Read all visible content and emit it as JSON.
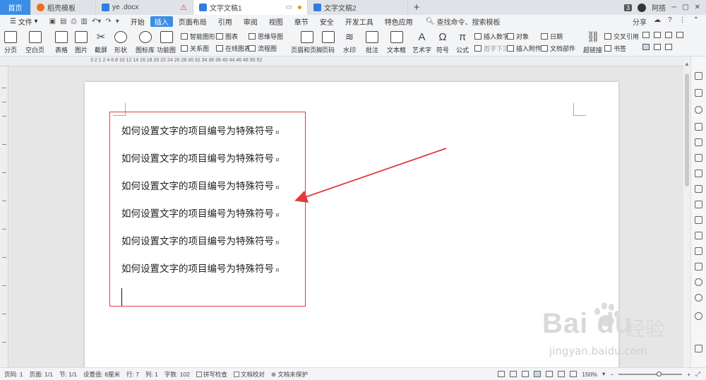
{
  "tabs": [
    {
      "label": "首页",
      "icon": "home-tab"
    },
    {
      "label": "稻壳模板",
      "icon": "docer-icon"
    },
    {
      "label": "ye .docx",
      "icon": "word-doc-icon"
    },
    {
      "label": "文字文稿1",
      "icon": "word-doc-icon"
    },
    {
      "label": "文字文稿2",
      "icon": "word-doc-icon"
    }
  ],
  "tab_add": "+",
  "topright": {
    "badge": "3",
    "user": "阿搭"
  },
  "menu": {
    "file": "文件",
    "items": [
      "开始",
      "插入",
      "页面布局",
      "引用",
      "审阅",
      "视图",
      "章节",
      "安全",
      "开发工具",
      "特色应用"
    ],
    "active": "插入",
    "search": "查找命令、搜索模板",
    "share": "分享"
  },
  "ribbon": {
    "big": [
      "分页",
      "空白页",
      "表格",
      "图片",
      "截屏",
      "形状",
      "图标库",
      "功能图",
      "页眉和页脚",
      "页码",
      "水印",
      "批注",
      "文本框",
      "艺术字",
      "符号",
      "公式",
      "超链接"
    ],
    "small": {
      "smart_art": "智能图形",
      "chart": "图表",
      "mindmap": "思维导图",
      "relation": "关系图",
      "online_chart": "在线图表",
      "flowchart": "流程图",
      "insert_number": "插入数字",
      "object": "对象",
      "date": "日期",
      "first_char": "首字下沉",
      "attachment": "插入附件",
      "doc_parts": "文档部件",
      "cross_ref": "交叉引用",
      "bookmark": "书签"
    }
  },
  "ruler": "3  2  1      2  4  6  8  10  12  14  16  18  20  22  24  26  28  30  32  34  36  38  40    44  46  48  50  52",
  "document": {
    "lines": [
      "如何设置文字的项目编号为特殊符号",
      "如何设置文字的项目编号为特殊符号",
      "如何设置文字的项目编号为特殊符号",
      "如何设置文字的项目编号为特殊符号",
      "如何设置文字的项目编号为特殊符号",
      "如何设置文字的项目编号为特殊符号"
    ],
    "para_mark": "¤",
    "annotation_color": "#e33b3b"
  },
  "watermark": {
    "main": "Bai du",
    "cn": "经验",
    "url": "jingyan.baidu.com"
  },
  "status": {
    "page_num": "页码: 1",
    "pages": "页面: 1/1",
    "section": "节: 1/1",
    "setting": "设置值: 8厘米",
    "row": "行: 7",
    "col": "列: 1",
    "words": "字数: 102",
    "spell": "拼写检查",
    "proof": "文档校对",
    "protect": "文档未保护",
    "zoom": "150%"
  }
}
